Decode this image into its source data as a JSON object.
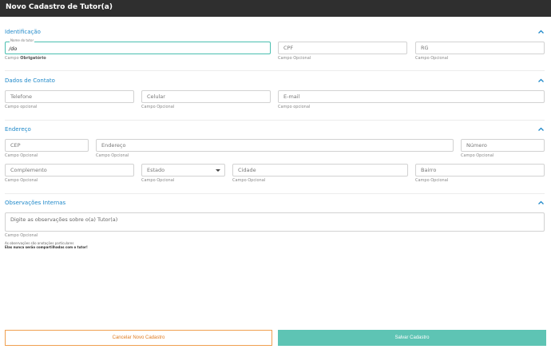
{
  "header": {
    "title": "Novo Cadastro de Tutor(a)"
  },
  "sections": {
    "identificacao": {
      "title": "Identificação"
    },
    "contato": {
      "title": "Dados de Contato"
    },
    "endereco": {
      "title": "Endereço"
    },
    "observacoes": {
      "title": "Observações Internas"
    }
  },
  "fields": {
    "nome": {
      "label": "Nome do tutor",
      "value": "/do",
      "hint_prefix": "Campo ",
      "hint_strong": "Obrigatório"
    },
    "cpf": {
      "placeholder": "CPF",
      "hint": "Campo Opcional"
    },
    "rg": {
      "placeholder": "RG",
      "hint": "Campo Opcional"
    },
    "telefone": {
      "placeholder": "Telefone",
      "hint": "Campo opcional"
    },
    "celular": {
      "placeholder": "Celular",
      "hint": "Campo Opcional"
    },
    "email": {
      "placeholder": "E-mail",
      "hint": "Campo opcional"
    },
    "cep": {
      "placeholder": "CEP",
      "hint": "Campo Opcional"
    },
    "endereco": {
      "placeholder": "Endereço",
      "hint": "Campo Opcional"
    },
    "numero": {
      "placeholder": "Número",
      "hint": "Campo Opcional"
    },
    "complemento": {
      "placeholder": "Complemento",
      "hint": "Campo Opcional"
    },
    "estado": {
      "placeholder": "Estado",
      "hint": "Campo Opcional"
    },
    "cidade": {
      "placeholder": "Cidade",
      "hint": "Campo Opcional"
    },
    "bairro": {
      "placeholder": "Bairro",
      "hint": "Campo Opcional"
    },
    "observacoes": {
      "placeholder": "Digite as observações sobre o(a) Tutor(a)",
      "hint": "Campo Opcional"
    }
  },
  "notes": {
    "line1": "As observações são anotações particulares",
    "line2": "Elas nunca serão compartilhadas com o tutor!"
  },
  "buttons": {
    "cancel": "Cancelar Novo Cadastro",
    "save": "Salvar Cadastro"
  },
  "colors": {
    "accent": "#1e88c9",
    "teal": "#5ec4b4",
    "orange": "#e07b20",
    "header_bg": "#2f2f2f"
  }
}
